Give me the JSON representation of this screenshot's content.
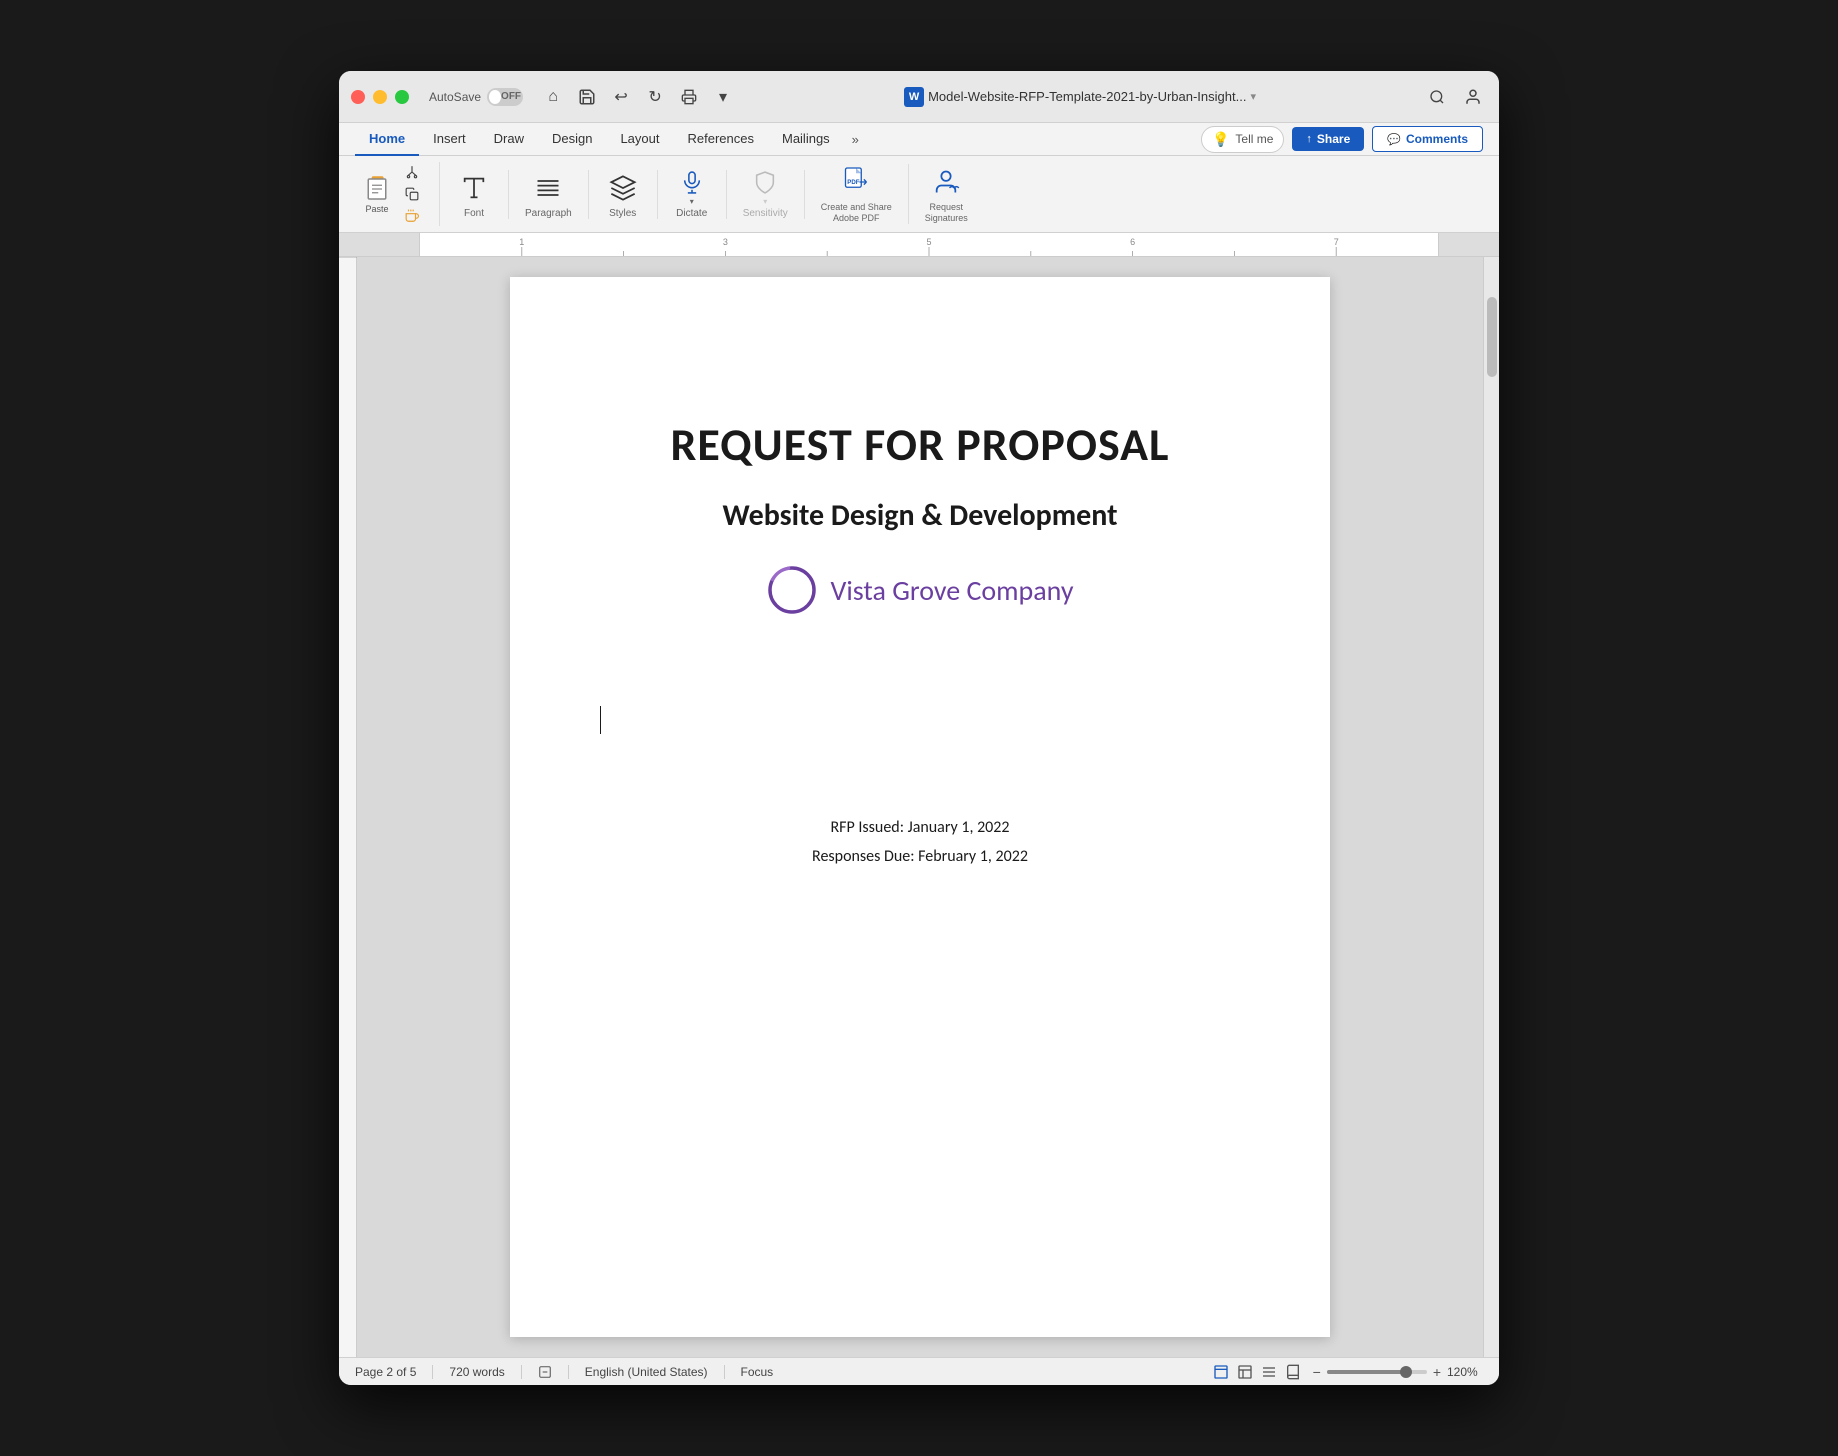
{
  "window": {
    "title": "Model-Website-RFP-Template-2021-by-Urban-Insight...",
    "word_icon": "W"
  },
  "titlebar": {
    "autosave_label": "AutoSave",
    "toggle_label": "OFF",
    "home_icon": "⌂",
    "save_icon": "💾",
    "undo_icon": "↩",
    "redo_icon": "↻",
    "print_icon": "🖨",
    "more_icon": "▾"
  },
  "share_btn": "Share",
  "comments_btn": "Comments",
  "ribbon": {
    "tabs": [
      "Home",
      "Insert",
      "Draw",
      "Design",
      "Layout",
      "References",
      "Mailings"
    ],
    "active_tab": "Home",
    "more_label": "»",
    "tell_me_placeholder": "Tell me"
  },
  "groups": {
    "paste": {
      "label": "Paste",
      "cut_icon": "✂",
      "copy_icon": "📋",
      "format_painter_icon": "🖌"
    },
    "font": {
      "label": "Font"
    },
    "paragraph": {
      "label": "Paragraph"
    },
    "styles": {
      "label": "Styles"
    },
    "dictate": {
      "label": "Dictate"
    },
    "sensitivity": {
      "label": "Sensitivity",
      "disabled": true
    },
    "adobe_pdf": {
      "label": "Create and Share\nAdobe PDF"
    },
    "signatures": {
      "label": "Request\nSignatures"
    }
  },
  "document": {
    "main_title": "REQUEST FOR PROPOSAL",
    "subtitle": "Website Design & Development",
    "company_name": "Vista Grove Company",
    "rfp_issued": "RFP Issued: January 1, 2022",
    "responses_due": "Responses Due: February 1, 2022"
  },
  "statusbar": {
    "page_info": "Page 2 of 5",
    "word_count": "720 words",
    "language": "English (United States)",
    "focus": "Focus",
    "zoom": "120%"
  },
  "colors": {
    "accent_blue": "#185abd",
    "company_purple": "#6b3fa0",
    "logo_purple_dark": "#5c3490",
    "logo_purple_light": "#9b6ac8"
  }
}
